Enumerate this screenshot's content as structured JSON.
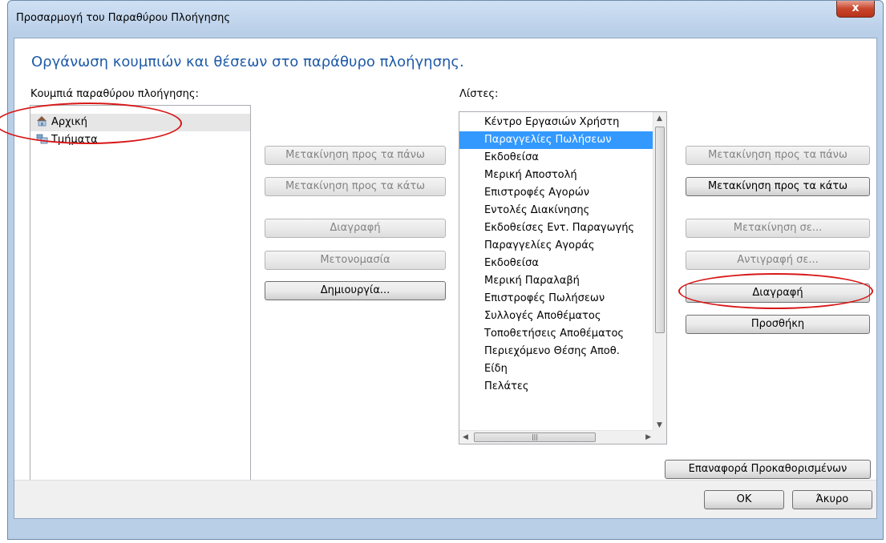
{
  "window": {
    "title": "Προσαρμογή του Παραθύρου Πλοήγησης",
    "close_label": "x"
  },
  "heading": "Οργάνωση κουμπιών και θέσεων στο παράθυρο πλοήγησης.",
  "left": {
    "label": "Κουμπιά παραθύρου πλοήγησης:",
    "items": [
      {
        "label": "Αρχική",
        "icon": "home-icon"
      },
      {
        "label": "Τμήματα",
        "icon": "departments-icon"
      }
    ]
  },
  "middle_buttons": {
    "move_up": "Μετακίνηση προς τα πάνω",
    "move_down": "Μετακίνηση προς τα κάτω",
    "delete": "Διαγραφή",
    "rename": "Μετονομασία",
    "create": "Δημιουργία..."
  },
  "lists": {
    "label": "Λίστες:",
    "items": [
      "Κέντρο Εργασιών Χρήστη",
      "Παραγγελίες Πωλήσεων",
      "Εκδοθείσα",
      "Μερική Αποστολή",
      "Επιστροφές Αγορών",
      "Εντολές Διακίνησης",
      "Εκδοθείσες Εντ. Παραγωγής",
      "Παραγγελίες Αγοράς",
      "Εκδοθείσα",
      "Μερική Παραλαβή",
      "Επιστροφές Πωλήσεων",
      "Συλλογές Αποθέματος",
      "Τοποθετήσεις Αποθέματος",
      "Περιεχόμενο Θέσης Αποθ.",
      "Είδη",
      "Πελάτες"
    ],
    "selected_index": 1
  },
  "right_buttons": {
    "move_up": "Μετακίνηση προς τα πάνω",
    "move_down": "Μετακίνηση προς τα κάτω",
    "move_to": "Μετακίνηση σε...",
    "copy_to": "Αντιγραφή σε...",
    "delete": "Διαγραφή",
    "add": "Προσθήκη"
  },
  "reset_button": "Επαναφορά Προκαθορισμένων",
  "footer": {
    "ok": "OK",
    "cancel": "Άκυρο"
  },
  "colors": {
    "heading": "#1e5aa8",
    "selection": "#3399ff",
    "annotation": "#d81818"
  }
}
